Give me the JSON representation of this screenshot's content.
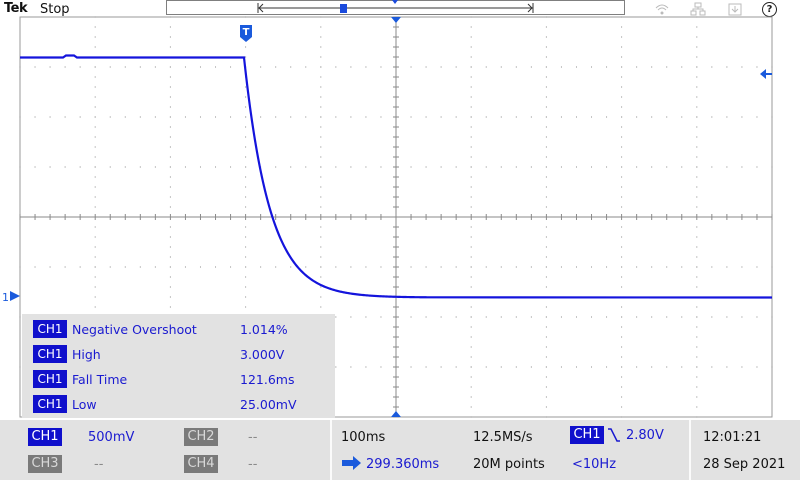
{
  "top": {
    "brand": "Tek",
    "acq_state": "Stop",
    "status_icons": [
      "wifi-icon",
      "network-icon",
      "save-icon",
      "help-icon"
    ],
    "help_glyph": "?"
  },
  "display": {
    "trigger_marker": "T",
    "ch1_marker": "1",
    "grid_divisions": {
      "horizontal": 10,
      "vertical": 8
    },
    "trace_color": "#1414dc",
    "background_color": "#ffffff"
  },
  "measurements": [
    {
      "channel": "CH1",
      "name": "Negative Overshoot",
      "value": "1.014%"
    },
    {
      "channel": "CH1",
      "name": "High",
      "value": "3.000V"
    },
    {
      "channel": "CH1",
      "name": "Fall Time",
      "value": "121.6ms"
    },
    {
      "channel": "CH1",
      "name": "Low",
      "value": "25.00mV"
    }
  ],
  "status": {
    "ch1": {
      "label": "CH1",
      "scale": "500mV"
    },
    "ch2": {
      "label": "CH2",
      "scale": "--"
    },
    "ch3": {
      "label": "CH3",
      "scale": "--"
    },
    "ch4": {
      "label": "CH4",
      "scale": "--"
    },
    "horizontal": {
      "scale": "100ms",
      "position": "299.360ms"
    },
    "acquisition": {
      "sample_rate": "12.5MS/s",
      "record_length": "20M points"
    },
    "trigger": {
      "source": "CH1",
      "level": "2.80V",
      "frequency": "<10Hz"
    },
    "clock": {
      "time": "12:01:21",
      "date": "28 Sep 2021"
    }
  },
  "colors": {
    "ch1": "#1414dc",
    "ch_off": "#7a7a7a",
    "panel": "#e2e2e2"
  }
}
